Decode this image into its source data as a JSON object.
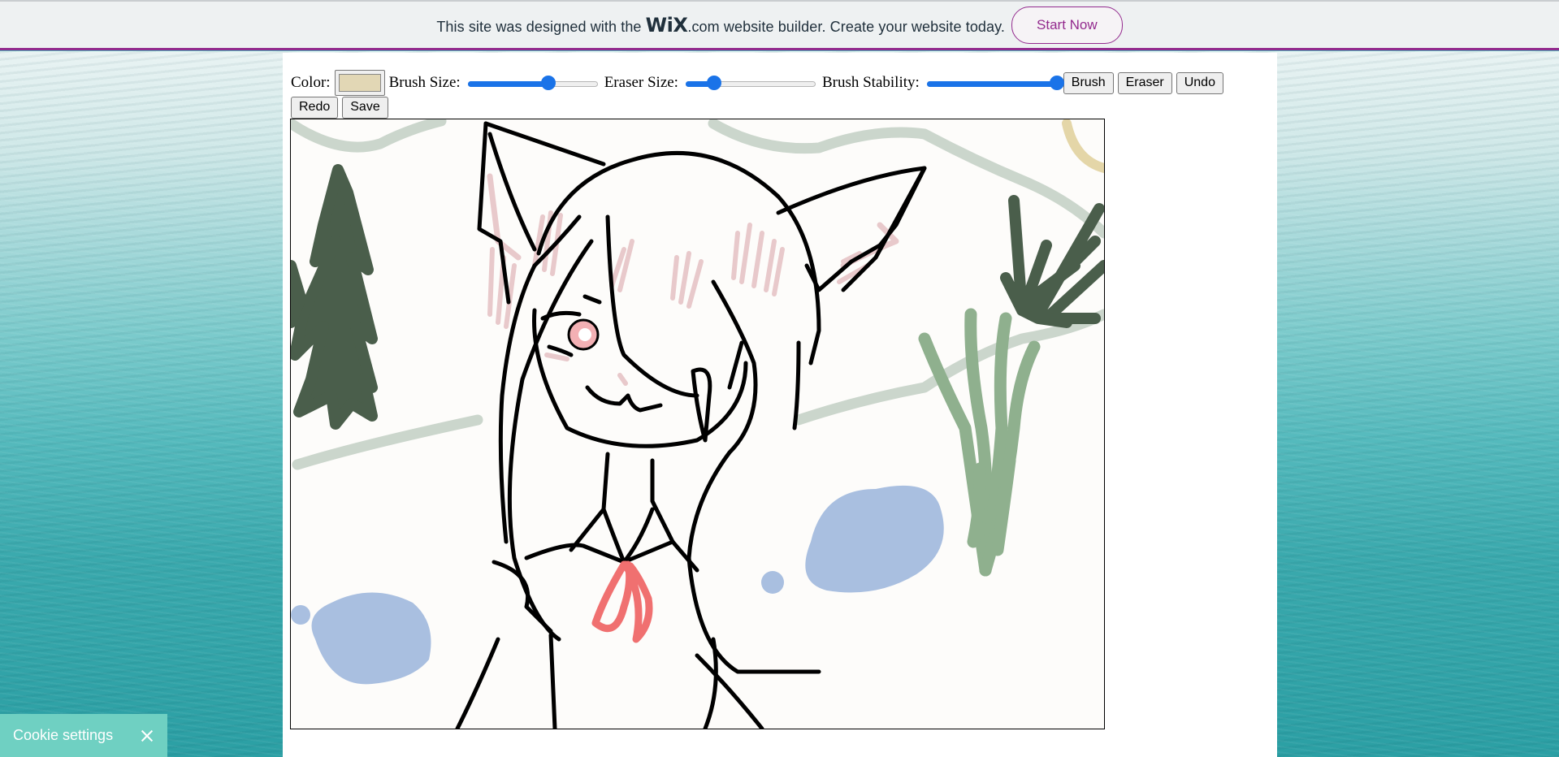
{
  "banner": {
    "prefix": "This site was designed with the",
    "logo": "WiX",
    "suffix": ".com website builder. Create your website today.",
    "cta": "Start Now",
    "accent": "#932a8e"
  },
  "toolbar": {
    "color_label": "Color:",
    "color_value": "#e2d7b5",
    "brush_size_label": "Brush Size:",
    "brush_size_fraction": 0.62,
    "eraser_size_label": "Eraser Size:",
    "eraser_size_fraction": 0.22,
    "stability_label": "Brush Stability:",
    "stability_fraction": 1.0,
    "buttons": {
      "brush": "Brush",
      "eraser": "Eraser",
      "undo": "Undo",
      "redo": "Redo",
      "save": "Save"
    }
  },
  "canvas": {
    "drawing": "doodle-cat-girl",
    "palette": {
      "ink": "#000000",
      "tree": "#4a5e4b",
      "grass": "#8fb08e",
      "water": "#a9bfe0",
      "hill": "#cbd6cc",
      "blush": "#e8c9cb",
      "accent_red": "#f07070",
      "sun": "#e4d6a8"
    }
  },
  "cookie": {
    "label": "Cookie settings",
    "close_icon": "close-icon"
  }
}
